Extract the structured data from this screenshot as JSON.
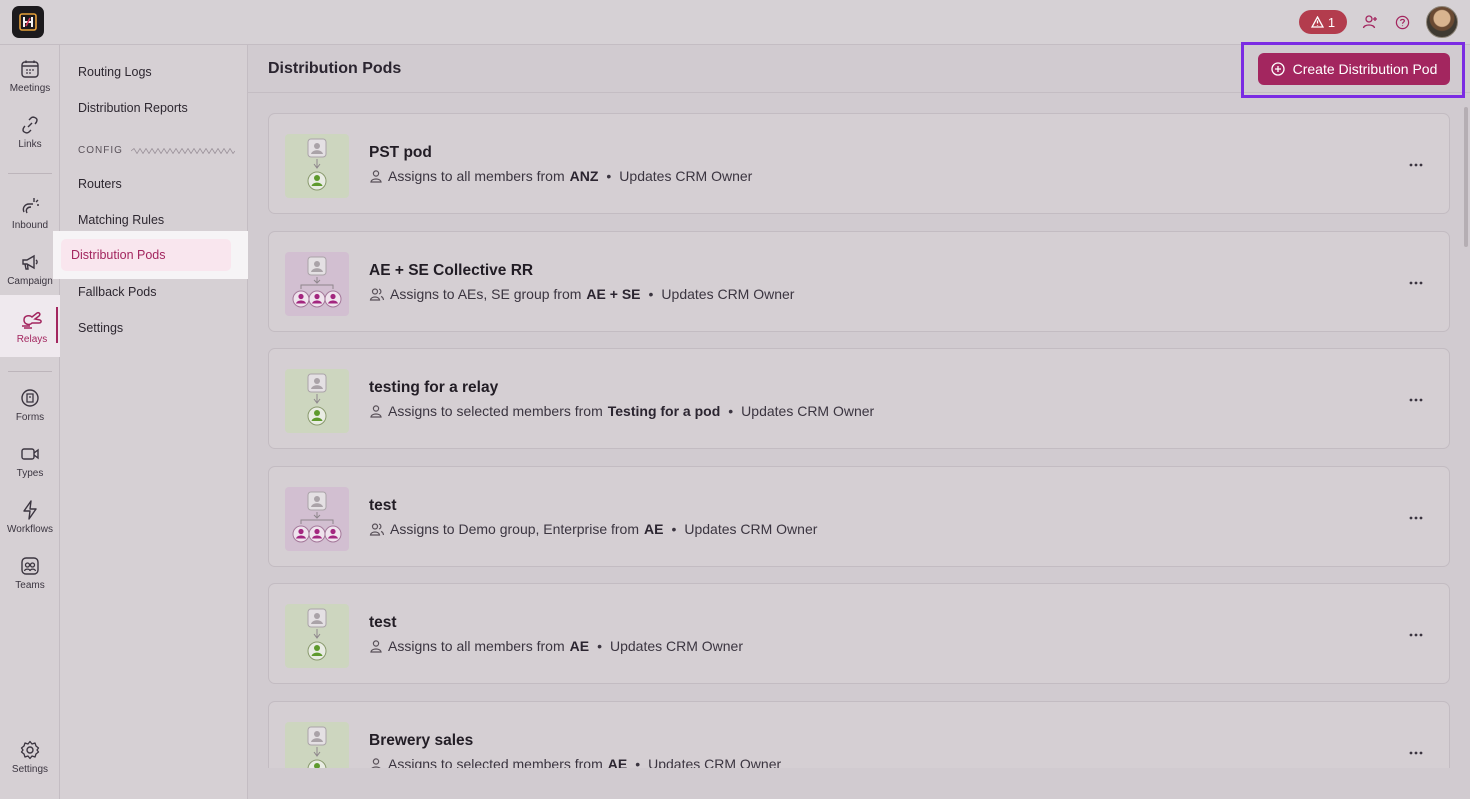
{
  "topbar": {
    "alert_count": "1"
  },
  "rail": {
    "items": [
      {
        "label": "Meetings",
        "icon": "calendar-icon"
      },
      {
        "label": "Links",
        "icon": "link-icon"
      },
      {
        "label": "Inbound",
        "icon": "inbound-icon"
      },
      {
        "label": "Campaign",
        "icon": "megaphone-icon"
      },
      {
        "label": "Relays",
        "icon": "relay-icon"
      },
      {
        "label": "Forms",
        "icon": "forms-icon"
      },
      {
        "label": "Types",
        "icon": "video-icon"
      },
      {
        "label": "Workflows",
        "icon": "lightning-icon"
      },
      {
        "label": "Teams",
        "icon": "teams-icon"
      },
      {
        "label": "Settings",
        "icon": "gear-icon"
      }
    ],
    "active": "Relays"
  },
  "submenu": {
    "routing_logs": "Routing Logs",
    "distribution_reports": "Distribution Reports",
    "config_section": "CONFIG",
    "routers": "Routers",
    "matching_rules": "Matching Rules",
    "distribution_pods": "Distribution Pods",
    "fallback_pods": "Fallback Pods",
    "settings": "Settings"
  },
  "main": {
    "title": "Distribution Pods",
    "create_button": "Create Distribution Pod",
    "pods": [
      {
        "title": "PST pod",
        "assign_prefix": "Assigns to all members from",
        "group": "ANZ",
        "updates": "Updates CRM Owner",
        "kind": "single"
      },
      {
        "title": "AE + SE Collective RR",
        "assign_prefix": "Assigns to AEs, SE group from",
        "group": "AE + SE",
        "updates": "Updates CRM Owner",
        "kind": "multi"
      },
      {
        "title": "testing for a relay",
        "assign_prefix": "Assigns to selected members from",
        "group": "Testing for a pod",
        "updates": "Updates CRM Owner",
        "kind": "single"
      },
      {
        "title": "test",
        "assign_prefix": "Assigns to Demo group, Enterprise from",
        "group": "AE",
        "updates": "Updates CRM Owner",
        "kind": "multi"
      },
      {
        "title": "test",
        "assign_prefix": "Assigns to all members from",
        "group": "AE",
        "updates": "Updates CRM Owner",
        "kind": "single"
      },
      {
        "title": "Brewery sales",
        "assign_prefix": "Assigns to selected members from",
        "group": "AE",
        "updates": "Updates CRM Owner",
        "kind": "single"
      }
    ]
  },
  "colors": {
    "accent": "#a3265f",
    "highlight_frame": "#7b2be3",
    "alert": "#b33c4d"
  }
}
